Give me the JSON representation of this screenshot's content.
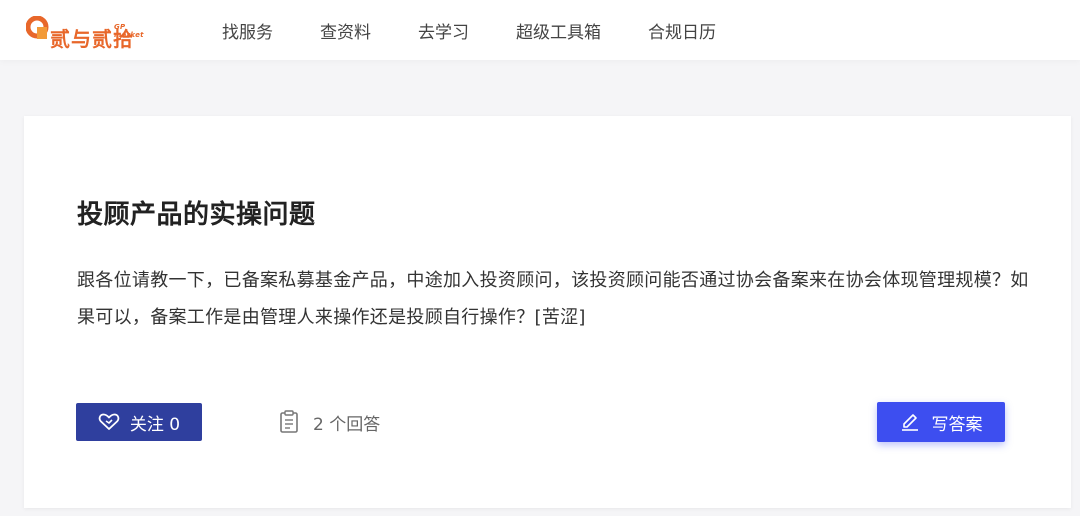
{
  "header": {
    "logo": {
      "text": "贰与贰拾",
      "sub": "GP market",
      "brand_color": "#e8672a"
    },
    "nav": [
      {
        "label": "找服务"
      },
      {
        "label": "查资料"
      },
      {
        "label": "去学习"
      },
      {
        "label": "超级工具箱"
      },
      {
        "label": "合规日历"
      }
    ]
  },
  "question": {
    "title": "投顾产品的实操问题",
    "body": "跟各位请教一下，已备案私募基金产品，中途加入投资顾问，该投资顾问能否通过协会备案来在协会体现管理规模？如果可以，备案工作是由管理人来操作还是投顾自行操作？[苦涩]",
    "follow_label": "关注 0",
    "follow_icon": "heart-outline-icon",
    "answers_label": "2 个回答",
    "answers_icon": "clipboard-icon",
    "write_label": "写答案",
    "write_icon": "pencil-icon"
  },
  "colors": {
    "follow_button": "#2f3f9e",
    "write_button": "#3d4ef0",
    "background": "#f5f5f7"
  }
}
